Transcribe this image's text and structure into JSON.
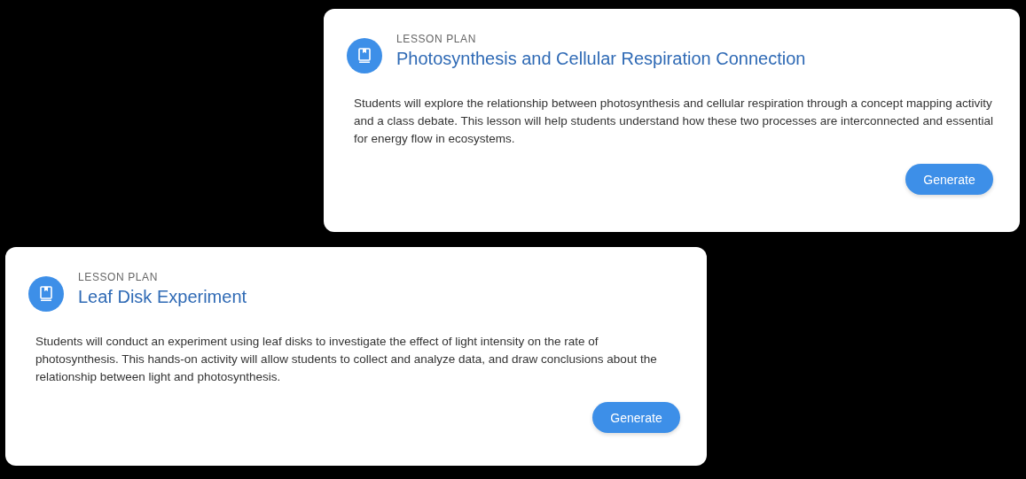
{
  "cards": [
    {
      "label": "LESSON PLAN",
      "title": "Photosynthesis and Cellular Respiration Connection",
      "description": "Students will explore the relationship between photosynthesis and cellular respiration through a concept mapping activity and a class debate. This lesson will help students understand how these two processes are interconnected and essential for energy flow in ecosystems.",
      "button": "Generate"
    },
    {
      "label": "LESSON PLAN",
      "title": "Leaf Disk Experiment",
      "description": "Students will conduct an experiment using leaf disks to investigate the effect of light intensity on the rate of photosynthesis. This hands-on activity will allow students to collect and analyze data, and draw conclusions about the relationship between light and photosynthesis.",
      "button": "Generate"
    }
  ]
}
